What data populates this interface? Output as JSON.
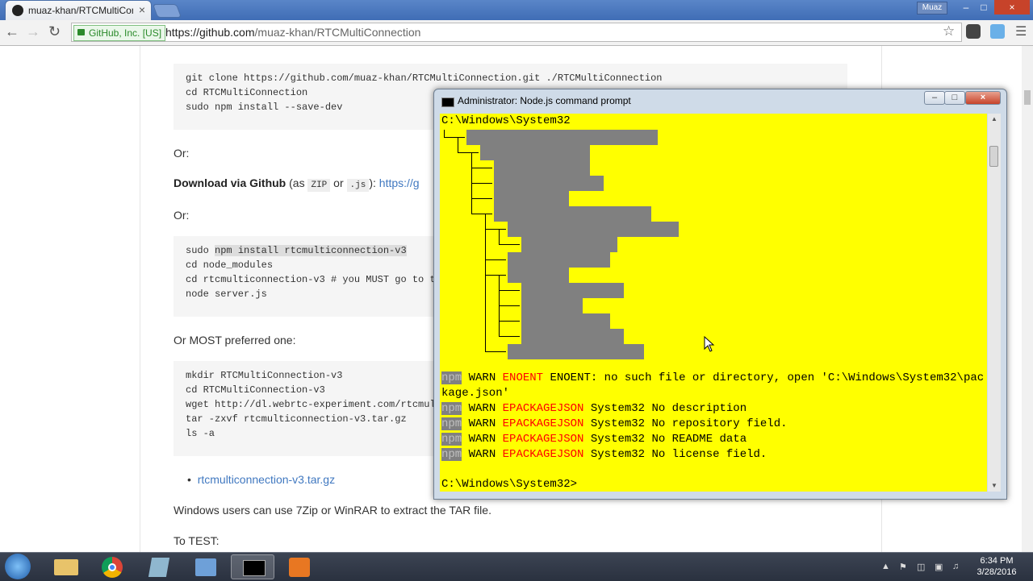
{
  "browser": {
    "tab_title": "muaz-khan/RTCMultiCon",
    "tab_close": "×",
    "user_label": "Muaz",
    "window_controls": [
      "–",
      "□",
      "×"
    ],
    "ev_label": "GitHub, Inc. [US]",
    "url_host": "https://github.com",
    "url_path": "/muaz-khan/RTCMultiConnection"
  },
  "page": {
    "code1": "git clone https://github.com/muaz-khan/RTCMultiConnection.git ./RTCMultiConnection\ncd RTCMultiConnection\nsudo npm install --save-dev",
    "or1": "Or:",
    "download_bold": "Download via Github",
    "download_as": "(as",
    "zip": "ZIP",
    "or_word": "or",
    "js": ".js",
    "close_paren": "):",
    "download_link": "https://g",
    "or2": "Or:",
    "code2_sudo": "sudo ",
    "code2_hl": "npm install rtcmulticonnection-v3",
    "code2_rest": "\ncd node_modules\ncd rtcmulticonnection-v3 # you MUST go to th\nnode server.js",
    "or_most": "Or MOST preferred one:",
    "code3": "mkdir RTCMultiConnection-v3\ncd RTCMultiConnection-v3\nwget http://dl.webrtc-experiment.com/rtcmult\ntar -zxvf rtcmulticonnection-v3.tar.gz\nls -a",
    "bullet_link": "rtcmulticonnection-v3.tar.gz",
    "windows_note": "Windows users can use 7Zip or WinRAR to extract the TAR file.",
    "to_test": "To TEST:"
  },
  "cmd": {
    "title": "Administrator: Node.js command prompt",
    "prompt1": "C:\\Windows\\System32",
    "warn1_npm": "npm",
    "warn1_a": " WARN ",
    "warn1_err": "ENOENT",
    "warn1_b": " ENOENT: no such file or directory, open 'C:\\Windows\\System32\\pac",
    "warn1_c": "kage.json'",
    "warn_lines": [
      {
        "npm": "npm",
        "warn": " WARN ",
        "code": "EPACKAGEJSON",
        "msg": " System32 No description"
      },
      {
        "npm": "npm",
        "warn": " WARN ",
        "code": "EPACKAGEJSON",
        "msg": " System32 No repository field."
      },
      {
        "npm": "npm",
        "warn": " WARN ",
        "code": "EPACKAGEJSON",
        "msg": " System32 No README data"
      },
      {
        "npm": "npm",
        "warn": " WARN ",
        "code": "EPACKAGEJSON",
        "msg": " System32 No license field."
      }
    ],
    "prompt2": "C:\\Windows\\System32>",
    "background": "#ffff00",
    "error_color": "#ff0000"
  },
  "taskbar": {
    "time": "6:34 PM",
    "date": "3/28/2016"
  }
}
